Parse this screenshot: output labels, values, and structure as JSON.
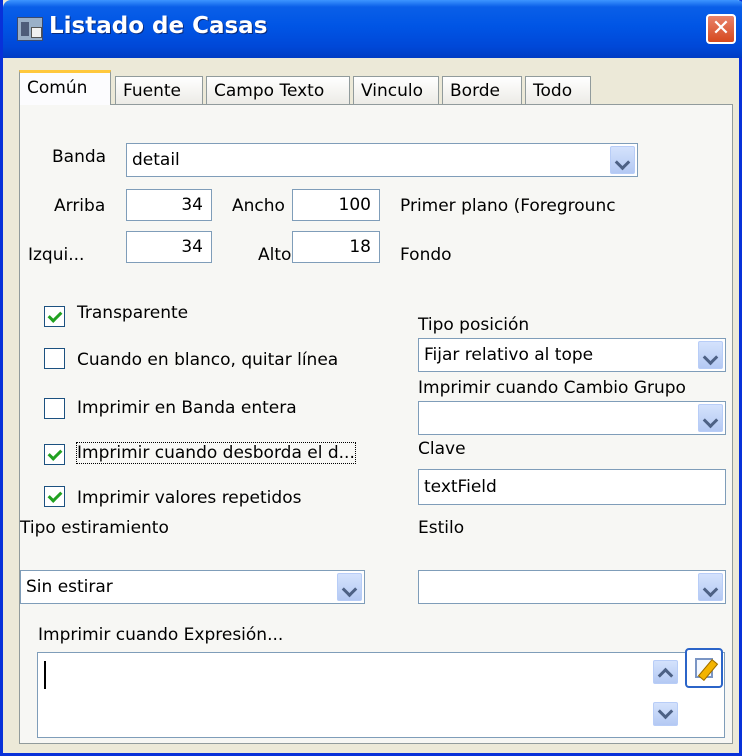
{
  "window": {
    "title": "Listado de Casas",
    "close_glyph": "✕"
  },
  "tabs": [
    "Común",
    "Fuente",
    "Campo Texto",
    "Vinculo",
    "Borde",
    "Todo"
  ],
  "form": {
    "banda_label": "Banda",
    "banda_value": "detail",
    "arriba_label": "Arriba",
    "arriba_value": "34",
    "ancho_label": "Ancho",
    "ancho_value": "100",
    "foreground_label": "Primer plano (Foregrounc",
    "izq_label": "Izqui...",
    "izq_value": "34",
    "alto_label": "Alto",
    "alto_value": "18",
    "fondo_label": "Fondo"
  },
  "checkboxes": [
    {
      "label": "Transparente",
      "checked": true
    },
    {
      "label": "Cuando en blanco, quitar línea",
      "checked": false
    },
    {
      "label": "Imprimir en Banda entera",
      "checked": false
    },
    {
      "label": "Imprimir cuando desborda el d...",
      "checked": true
    },
    {
      "label": "Imprimir valores repetidos",
      "checked": true
    }
  ],
  "right": {
    "tipo_posicion_label": "Tipo posición",
    "tipo_posicion_value": "Fijar relativo al tope",
    "cambio_grupo_label": "Imprimir cuando Cambio Grupo",
    "cambio_grupo_value": "",
    "clave_label": "Clave",
    "clave_value": "textField",
    "estilo_label": "Estilo",
    "estilo_value": ""
  },
  "stretch": {
    "label": "Tipo estiramiento",
    "value": "Sin estirar"
  },
  "expression": {
    "label": "Imprimir cuando Expresión...",
    "value": ""
  },
  "icons": {
    "app": "app-icon",
    "close": "close-icon",
    "dropdown": "chevron-down-icon",
    "edit": "edit-expression-icon"
  },
  "colors": {
    "titlebar": "#0055e5",
    "active_tab_accent": "#ffc83c",
    "check": "#21a121"
  }
}
